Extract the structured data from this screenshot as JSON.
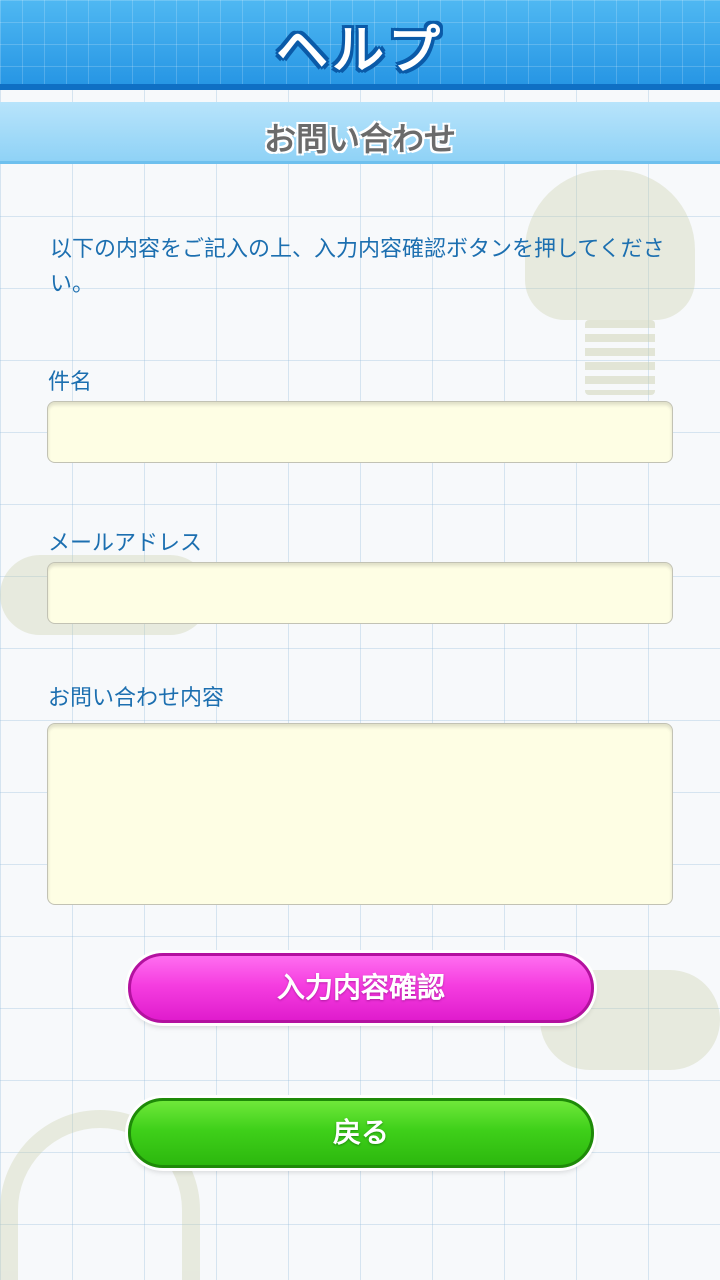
{
  "header": {
    "title": "ヘルプ"
  },
  "subheader": {
    "title": "お問い合わせ"
  },
  "instruction": "以下の内容をご記入の上、入力内容確認ボタンを押してください。",
  "form": {
    "subject_label": "件名",
    "subject_value": "",
    "email_label": "メールアドレス",
    "email_value": "",
    "message_label": "お問い合わせ内容",
    "message_value": ""
  },
  "buttons": {
    "confirm_label": "入力内容確認",
    "back_label": "戻る"
  },
  "colors": {
    "header": "#2796e4",
    "subheader": "#8fd2f6",
    "label_text": "#1c6fb0",
    "field_bg": "#fefee4",
    "confirm_button": "#f53ee0",
    "back_button": "#3fd01a"
  }
}
